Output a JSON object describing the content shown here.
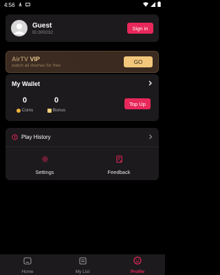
{
  "status_bar": {
    "time": "4:56"
  },
  "user": {
    "name": "Guest",
    "id_text": "ID:300232",
    "signin_label": "Sign in"
  },
  "vip": {
    "brand": "AirTV",
    "badge": "VIP",
    "subtitle": "watch all dramas for free",
    "go_label": "GO"
  },
  "wallet": {
    "title": "My Wallet",
    "coins_value": "0",
    "coins_label": "Coins",
    "bonus_value": "0",
    "bonus_label": "Bonus",
    "topup_label": "Top Up"
  },
  "menu": {
    "history_label": "Play History",
    "settings_label": "Settings",
    "feedback_label": "Feedback"
  },
  "nav": {
    "items": [
      {
        "label": "Home"
      },
      {
        "label": "My List"
      },
      {
        "label": "Profile"
      }
    ],
    "active_color": "#e8285a"
  },
  "colors": {
    "accent": "#e8285a",
    "gold": "#f2c77c",
    "card": "#1c1a1d"
  }
}
